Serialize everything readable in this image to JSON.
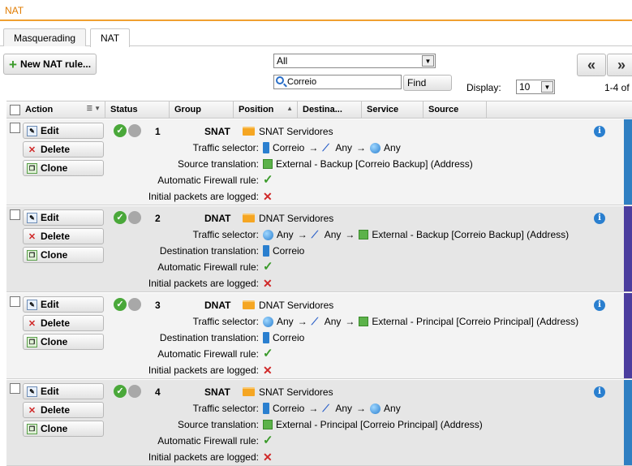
{
  "title": "NAT",
  "tabs": [
    {
      "label": "Masquerading"
    },
    {
      "label": "NAT"
    }
  ],
  "toolbar": {
    "new_rule_label": "New NAT rule...",
    "filter_value": "All",
    "search_value": "Correio",
    "find_label": "Find",
    "display_label": "Display:",
    "display_value": "10",
    "pager_text": "1-4 of",
    "nav_first": "«",
    "nav_next": "»"
  },
  "columns": [
    "Action",
    "Status",
    "Group",
    "Position",
    "Destina...",
    "Service",
    "Source"
  ],
  "action_labels": {
    "edit": "Edit",
    "delete": "Delete",
    "clone": "Clone"
  },
  "colors": {
    "accent": "#f0a030",
    "title": "#e07b00",
    "snat_bar": "#2f7fc2",
    "dnat_bar": "#4b3d9e",
    "check": "#3a9a2a",
    "cross": "#d02828"
  },
  "rules": [
    {
      "num": "1",
      "type": "SNAT",
      "group": "SNAT Servidores",
      "lines": [
        {
          "label": "Traffic selector:",
          "value": "Correio",
          "extra1": "Any",
          "extra2": "Any"
        },
        {
          "label": "Source translation:",
          "value": "External - Backup [Correio Backup] (Address)"
        },
        {
          "label": "Automatic Firewall rule:"
        },
        {
          "label": "Initial packets are logged:"
        }
      ]
    },
    {
      "num": "2",
      "type": "DNAT",
      "group": "DNAT Servidores",
      "lines": [
        {
          "label": "Traffic selector:",
          "value": "Any",
          "extra1": "Any",
          "extra2": "External - Backup [Correio Backup] (Address)"
        },
        {
          "label": "Destination translation:",
          "value": "Correio"
        },
        {
          "label": "Automatic Firewall rule:"
        },
        {
          "label": "Initial packets are logged:"
        }
      ]
    },
    {
      "num": "3",
      "type": "DNAT",
      "group": "DNAT Servidores",
      "lines": [
        {
          "label": "Traffic selector:",
          "value": "Any",
          "extra1": "Any",
          "extra2": "External - Principal [Correio Principal] (Address)"
        },
        {
          "label": "Destination translation:",
          "value": "Correio"
        },
        {
          "label": "Automatic Firewall rule:"
        },
        {
          "label": "Initial packets are logged:"
        }
      ]
    },
    {
      "num": "4",
      "type": "SNAT",
      "group": "SNAT Servidores",
      "lines": [
        {
          "label": "Traffic selector:",
          "value": "Correio",
          "extra1": "Any",
          "extra2": "Any"
        },
        {
          "label": "Source translation:",
          "value": "External - Principal [Correio Principal] (Address)"
        },
        {
          "label": "Automatic Firewall rule:"
        },
        {
          "label": "Initial packets are logged:"
        }
      ]
    }
  ]
}
